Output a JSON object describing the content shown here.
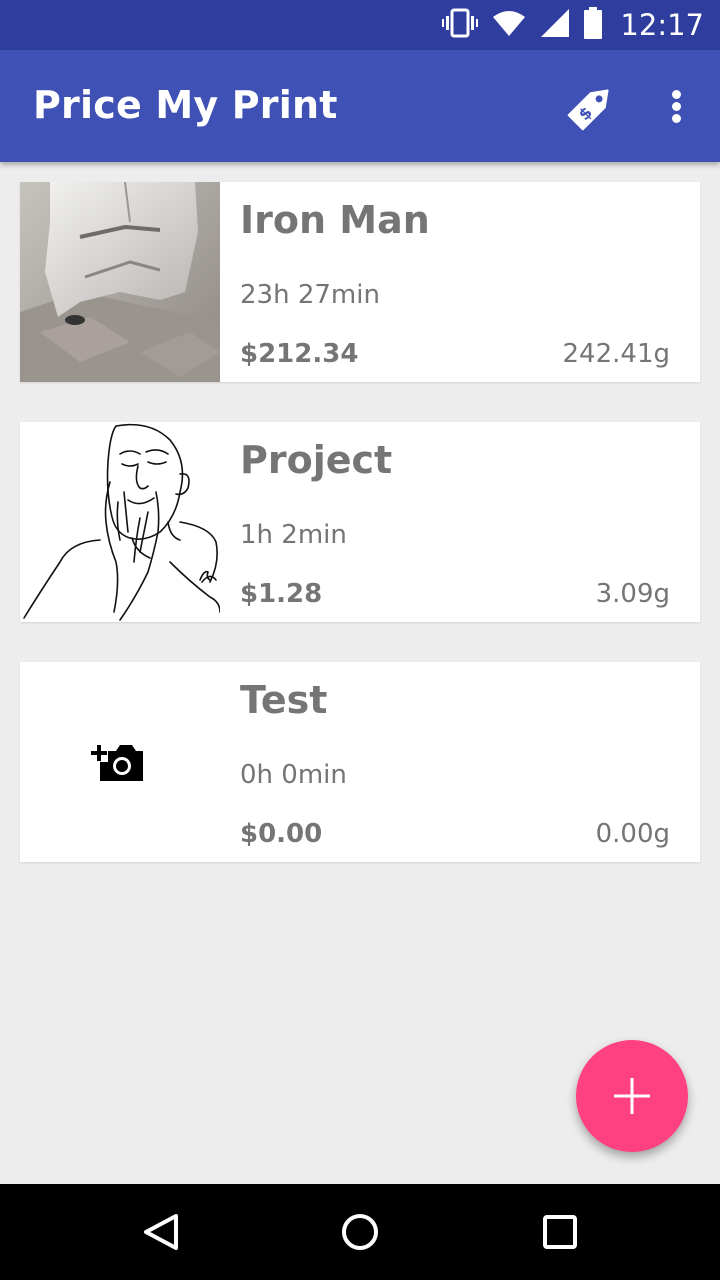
{
  "status_bar": {
    "time": "12:17",
    "icons": [
      "vibrate-icon",
      "wifi-icon",
      "cell-signal-icon",
      "battery-icon"
    ]
  },
  "app_bar": {
    "title": "Price My Print",
    "actions": [
      "price-tag-icon",
      "overflow-menu-icon"
    ]
  },
  "prints": [
    {
      "title": "Iron Man",
      "time": "23h 27min",
      "price": "$212.34",
      "weight": "242.41g",
      "thumbnail": "photo of white 3d printed helmet"
    },
    {
      "title": "Project",
      "time": "1h 2min",
      "price": "$1.28",
      "weight": "3.09g",
      "thumbnail": "line drawing of relieved face"
    },
    {
      "title": "Test",
      "time": "0h 0min",
      "price": "$0.00",
      "weight": "0.00g",
      "thumbnail": "add-photo-icon"
    }
  ],
  "fab": {
    "icon": "plus-icon"
  },
  "nav": [
    "back-icon",
    "home-icon",
    "recents-icon"
  ],
  "colors": {
    "primary_dark": "#2f3e9e",
    "primary": "#3f51b5",
    "accent": "#ff4081",
    "background": "#ededed",
    "text_secondary": "#757575"
  }
}
